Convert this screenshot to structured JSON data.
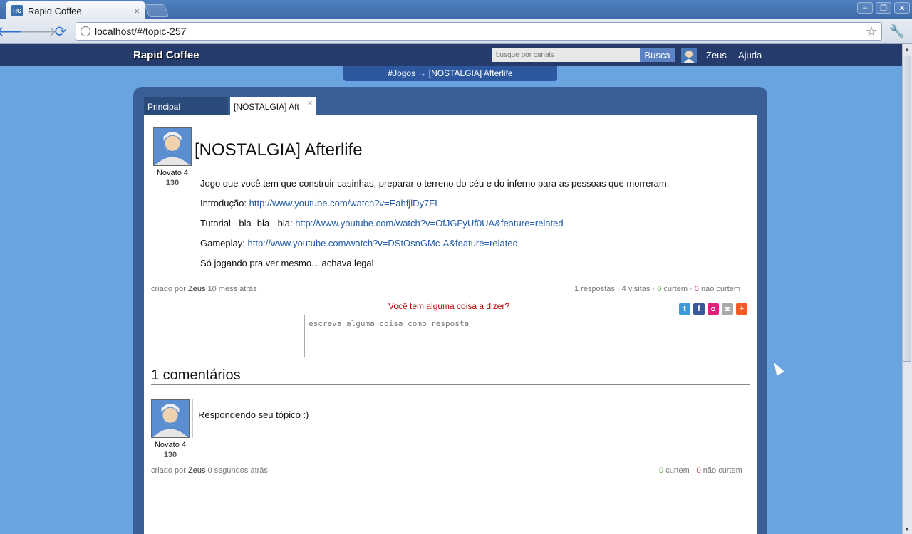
{
  "browser": {
    "tab_title": "Rapid Coffee",
    "tab_favicon": "RC",
    "tab_close": "×",
    "url": "localhost/#/topic-257"
  },
  "header": {
    "brand": "Rapid Coffee",
    "search_placeholder": "busque por canais",
    "search_button": "Busca",
    "user_name": "Zeus",
    "help": "Ajuda"
  },
  "breadcrumb": "#Jogos → [NOSTALGIA] Afterlife",
  "tabs": [
    {
      "label": "Principal"
    },
    {
      "label": "[NOSTALGIA] Aft",
      "close": "×"
    }
  ],
  "topic": {
    "title": "[NOSTALGIA] Afterlife",
    "author_rank": "Novato 4",
    "author_score": "130",
    "body": [
      {
        "text": "Jogo que você tem que construir casinhas, preparar o terreno do céu e do inferno para as pessoas que morreram.",
        "link": ""
      },
      {
        "text": "Introdução: ",
        "link": "http://www.youtube.com/watch?v=EahfjlDy7FI"
      },
      {
        "text": "Tutorial - bla -bla - bla: ",
        "link": "http://www.youtube.com/watch?v=OfJGFyUf0UA&feature=related"
      },
      {
        "text": "Gameplay: ",
        "link": "http://www.youtube.com/watch?v=DStOsnGMc-A&feature=related"
      },
      {
        "text": "Só jogando pra ver mesmo... achava legal",
        "link": ""
      }
    ],
    "created_by_label": "criado por",
    "created_by": "Zeus",
    "created_when": "10 mess atrás",
    "stats": {
      "replies": "1 respostas",
      "visits": "4 visitas",
      "likes": "0",
      "likes_label": "curtem",
      "dislikes": "0",
      "dislikes_label": "não curtem"
    }
  },
  "reply": {
    "prompt": "Você tem alguma coisa a dizer?",
    "placeholder": "escreva alguma coisa como resposta"
  },
  "share": [
    {
      "icon": "twitter-icon",
      "glyph": "t",
      "color": "#3d9ad6"
    },
    {
      "icon": "facebook-icon",
      "glyph": "f",
      "color": "#3b5998"
    },
    {
      "icon": "flickr-icon",
      "glyph": "o",
      "color": "#e0207a"
    },
    {
      "icon": "email-icon",
      "glyph": "✉",
      "color": "#aaaaaa"
    },
    {
      "icon": "addthis-icon",
      "glyph": "+",
      "color": "#f25b23"
    }
  ],
  "comments": {
    "heading": "1 comentários",
    "items": [
      {
        "text": "Respondendo seu tópico :)",
        "author_rank": "Novato 4",
        "author_score": "130",
        "created_by_label": "criado por",
        "created_by": "Zeus",
        "created_when": "0 segundos atrás",
        "likes": "0",
        "likes_label": "curtem",
        "dislikes": "0",
        "dislikes_label": "não curtem"
      }
    ]
  }
}
